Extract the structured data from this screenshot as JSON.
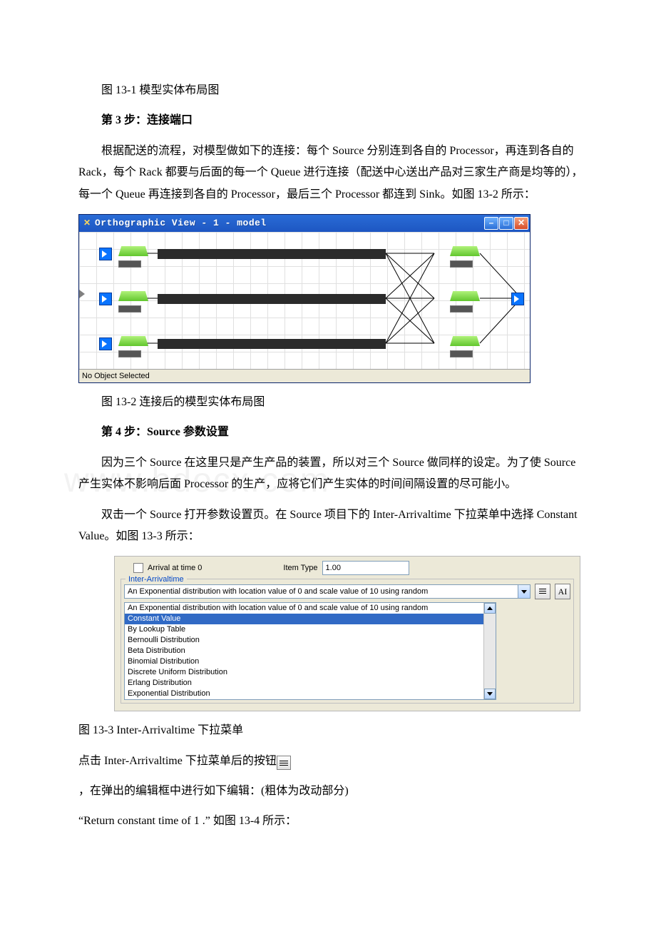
{
  "captions": {
    "fig13_1": "图 13-1 模型实体布局图",
    "step3_heading": "第 3 步：连接端口",
    "step3_para": "根据配送的流程，对模型做如下的连接：每个 Source 分别连到各自的 Processor，再连到各自的 Rack，每个 Rack 都要与后面的每一个 Queue 进行连接（配送中心送出产品对三家生产商是均等的），每一个 Queue 再连接到各自的 Processor，最后三个 Processor 都连到 Sink。如图 13-2 所示：",
    "fig13_2": "图 13-2 连接后的模型实体布局图",
    "step4_heading": "第 4 步：Source 参数设置",
    "step4_para1": "因为三个 Source 在这里只是产生产品的装置，所以对三个 Source 做同样的设定。为了使 Source 产生实体不影响后面 Processor 的生产，应将它们产生实体的时间间隔设置的尽可能小。",
    "step4_para2": "双击一个 Source 打开参数设置页。在 Source 项目下的 Inter-Arrivaltime 下拉菜单中选择 Constant Value。如图 13-3 所示：",
    "fig13_3": "图 13-3 Inter-Arrivaltime 下拉菜单",
    "after_fig13_3_a": "点击 Inter-Arrivaltime 下拉菜单后的按钮",
    "after_fig13_3_b": "，在弹出的编辑框中进行如下编辑：(粗体为改动部分)",
    "after_fig13_3_c": "“Return constant time of 1 .” 如图 13-4 所示："
  },
  "ortho_window": {
    "title": "Orthographic View - 1 - model",
    "status": "No Object Selected"
  },
  "panel": {
    "arrival_label": "Arrival at time 0",
    "itemtype_label": "Item Type",
    "itemtype_value": "1.00",
    "fieldset_legend": "Inter-Arrivaltime",
    "combobox_value": "An Exponential distribution with location value of 0   and scale value of 10   using random",
    "list": [
      "An Exponential distribution with location value of 0   and scale value of 10   using random",
      "Constant Value",
      "By Lookup Table",
      "Bernoulli Distribution",
      "Beta Distribution",
      "Binomial Distribution",
      "Discrete Uniform Distribution",
      "Erlang Distribution",
      "Exponential Distribution"
    ],
    "toolbtn_a": "AI"
  },
  "watermark": "www.bdocx.com"
}
